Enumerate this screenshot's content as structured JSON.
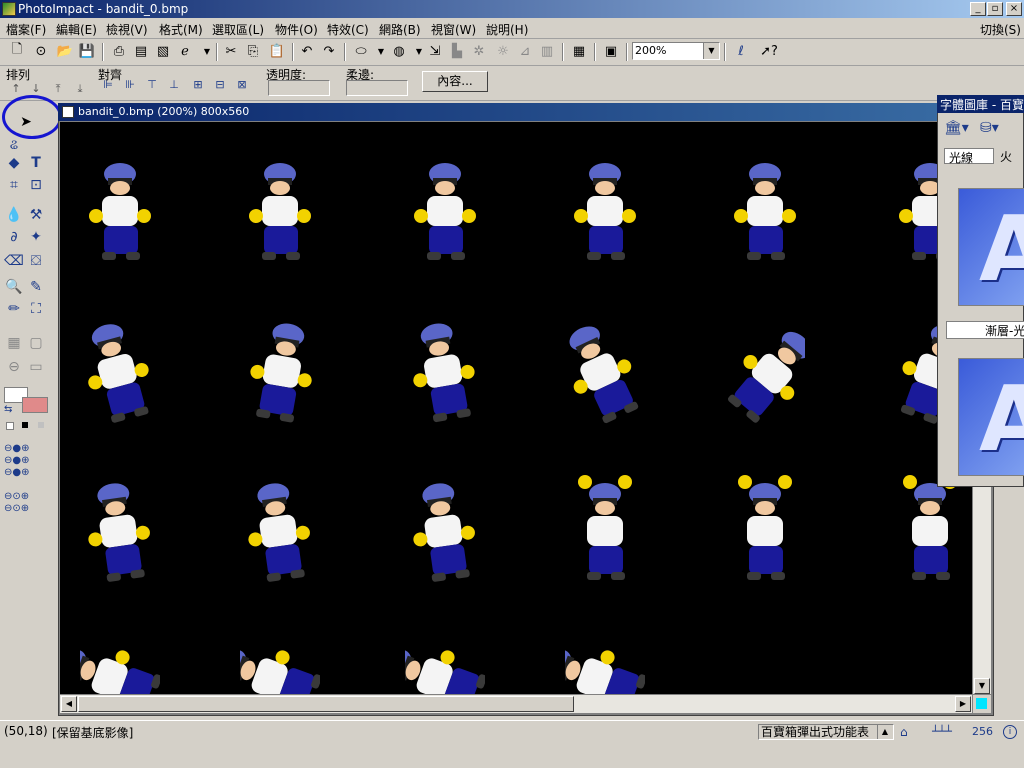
{
  "window": {
    "title": "PhotoImpact - bandit_0.bmp",
    "buttons": [
      "_",
      "▫",
      "×"
    ]
  },
  "menubar": {
    "items": [
      "檔案(F)",
      "編輯(E)",
      "檢視(V)",
      "格式(M)",
      "選取區(L)",
      "物件(O)",
      "特效(C)",
      "網路(B)",
      "視窗(W)",
      "說明(H)"
    ],
    "right_item": "切換(S)"
  },
  "toolbar": {
    "zoom_value": "200%"
  },
  "attrbar": {
    "arrange_label": "排列",
    "align_label": "對齊",
    "transparency_label": "透明度:",
    "softedge_label": "柔邊:",
    "content_button": "內容..."
  },
  "document": {
    "title": "bandit_0.bmp (200%) 800x560"
  },
  "library": {
    "title": "字體圖庫 - 百寶",
    "tabs": [
      "光線",
      "火"
    ],
    "tile_caption": "漸層-光",
    "tile_letter": "A"
  },
  "statusbar": {
    "coords": "(50,18)",
    "mode": "[保留基底影像]",
    "easypalette": "百寶箱彈出式功能表",
    "colors": "256"
  },
  "colors": {
    "title_blue": "#0a246a",
    "bandana": "#5a66c8",
    "shirt": "#f4f4f4",
    "pants": "#1a1a9a",
    "gloves": "#f2d200",
    "highlight_circle": "#1515d0"
  }
}
